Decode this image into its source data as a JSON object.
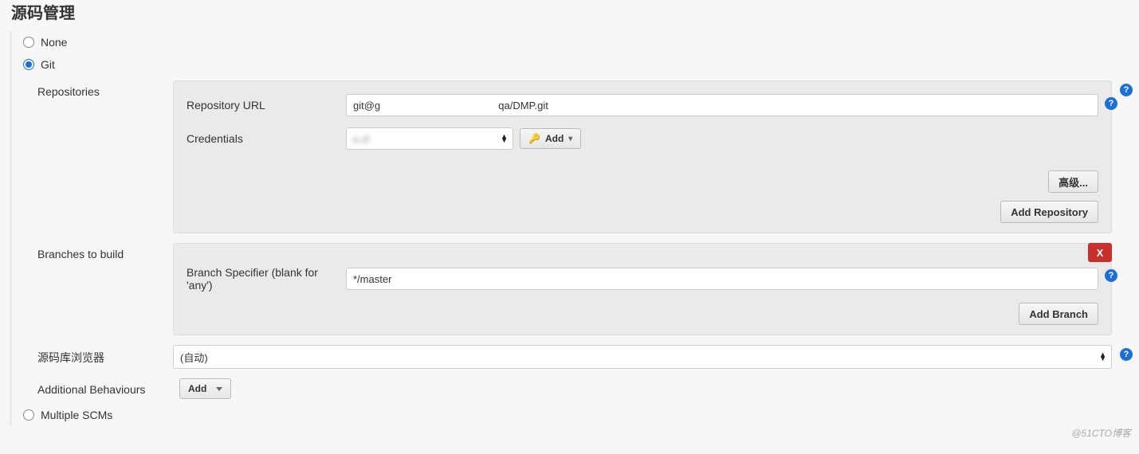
{
  "section_title": "源码管理",
  "scm_options": {
    "none": "None",
    "git": "Git",
    "multiple": "Multiple SCMs",
    "selected": "git"
  },
  "repositories": {
    "label": "Repositories",
    "repo_url_label": "Repository URL",
    "repo_url_value": "git@g                                         qa/DMP.git",
    "credentials_label": "Credentials",
    "credentials_value": "     o.zl",
    "add_label": "Add",
    "advanced_label": "高级...",
    "add_repository_label": "Add Repository"
  },
  "branches": {
    "label": "Branches to build",
    "specifier_label": "Branch Specifier (blank for 'any')",
    "specifier_value": "*/master",
    "add_branch_label": "Add Branch",
    "close_label": "X"
  },
  "browser": {
    "label": "源码库浏览器",
    "value": "(自动)"
  },
  "behaviours": {
    "label": "Additional Behaviours",
    "add_label": "Add"
  },
  "watermark": "@51CTO博客"
}
